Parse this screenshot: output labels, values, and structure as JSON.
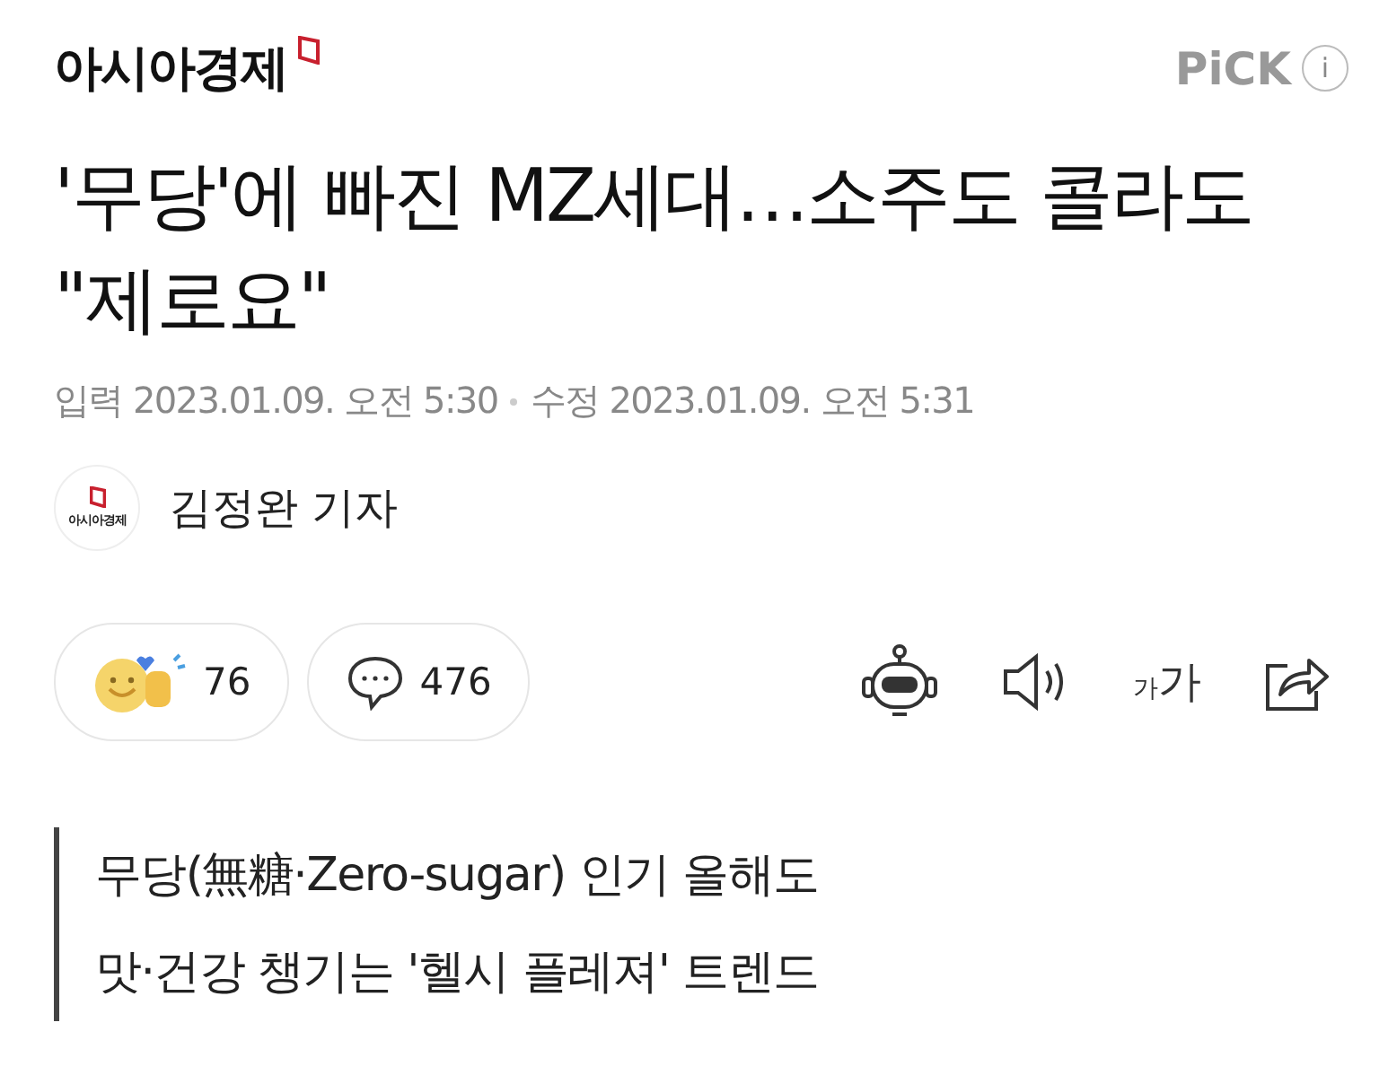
{
  "header": {
    "logo": "아시아경제",
    "pick": "PiCK",
    "info": "i"
  },
  "headline": "'무당'에 빠진 MZ세대…소주도 콜라도 \"제로요\"",
  "dates": {
    "input_label": "입력",
    "input_time": "2023.01.09. 오전 5:30",
    "edit_label": "수정",
    "edit_time": "2023.01.09. 오전 5:31"
  },
  "reporter": {
    "outlet_mark": "아시아경제",
    "name": "김정완 기자"
  },
  "actions": {
    "reactions": "76",
    "comments": "476",
    "font_small": "가",
    "font_large": "가"
  },
  "subtitle": [
    "무당(無糖·Zero-sugar) 인기 올해도",
    "맛·건강 챙기는 '헬시 플레져' 트렌드"
  ]
}
